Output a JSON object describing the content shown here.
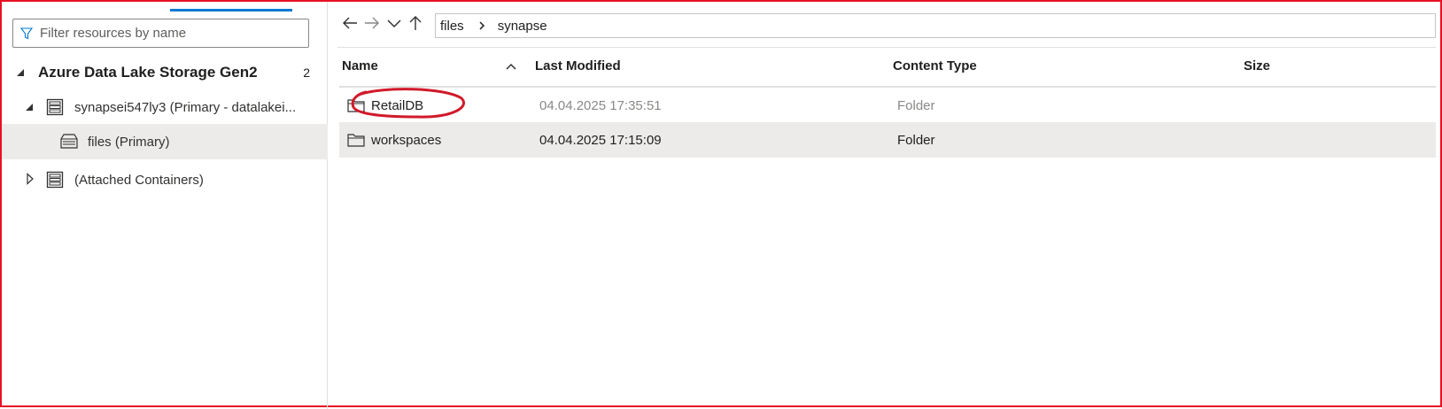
{
  "filter": {
    "placeholder": "Filter resources by name"
  },
  "tree": {
    "root_label": "Azure Data Lake Storage Gen2",
    "root_count": "2",
    "account_label": "synapsei547ly3 (Primary - datalakei...",
    "files_label": "files (Primary)",
    "attached_label": "(Attached Containers)"
  },
  "breadcrumb": {
    "items": [
      "files",
      "synapse"
    ]
  },
  "columns": {
    "name": "Name",
    "last_modified": "Last Modified",
    "content_type": "Content Type",
    "size": "Size"
  },
  "rows": [
    {
      "name": "RetailDB",
      "modified": "04.04.2025 17:35:51",
      "type": "Folder",
      "size": ""
    },
    {
      "name": "workspaces",
      "modified": "04.04.2025 17:15:09",
      "type": "Folder",
      "size": ""
    }
  ],
  "colors": {
    "accent": "#0078d4",
    "annotation": "#d11a2a",
    "frame": "#e81123"
  }
}
